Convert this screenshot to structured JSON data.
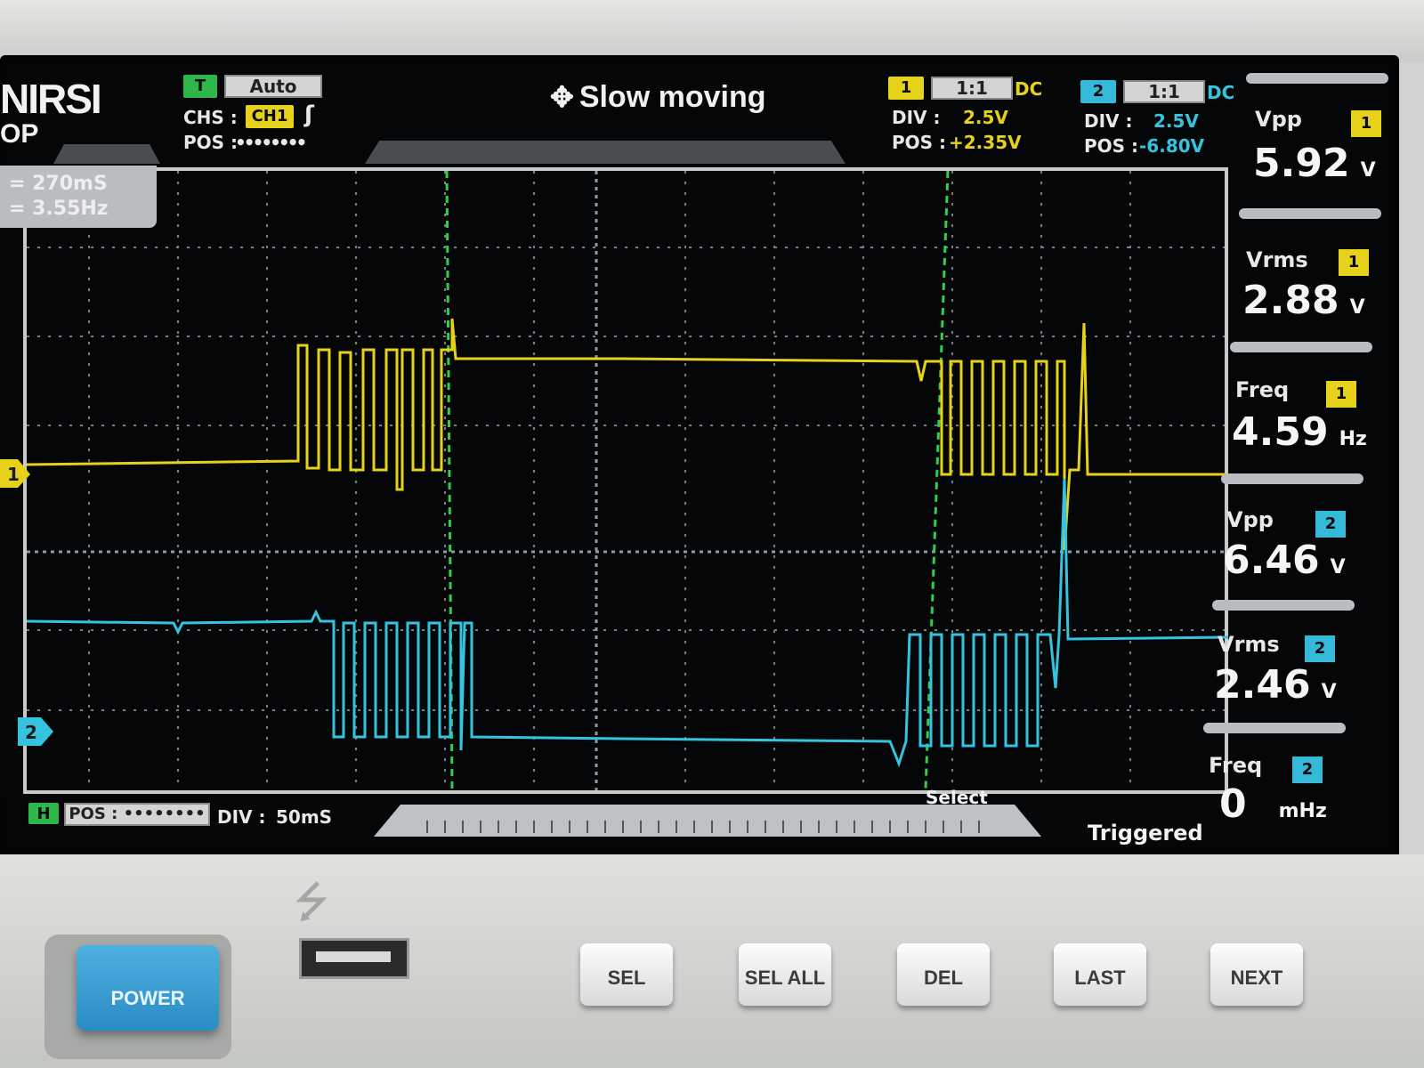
{
  "brand": {
    "logo": "NIRSI",
    "model_fragment": "OP"
  },
  "trigger": {
    "badge": "T",
    "mode": "Auto",
    "source_label": "CHS :",
    "source": "CH1",
    "edge_icon": "rising-edge-icon",
    "pos_label": "POS :",
    "pos_value": "••••••••"
  },
  "mode_indicator": {
    "icon": "move-arrows-icon",
    "text": "Slow moving"
  },
  "ch1": {
    "badge": "1",
    "probe": "1:1",
    "coupling": "DC",
    "div_label": "DIV :",
    "div_value": "2.5V",
    "pos_label": "POS :",
    "pos_value": "+2.35V",
    "marker": "1",
    "color": "#e6d21a"
  },
  "ch2": {
    "badge": "2",
    "probe": "1:1",
    "coupling": "DC",
    "div_label": "DIV :",
    "div_value": "2.5V",
    "pos_label": "POS :",
    "pos_value": "-6.80V",
    "marker": "2",
    "color": "#35c4e0"
  },
  "cursor_readout": {
    "line1": "= 270mS",
    "line2": "= 3.55Hz"
  },
  "measurements": [
    {
      "name": "Vpp",
      "channel": "1",
      "value": "5.92",
      "unit": "V"
    },
    {
      "name": "Vrms",
      "channel": "1",
      "value": "2.88",
      "unit": "V"
    },
    {
      "name": "Freq",
      "channel": "1",
      "value": "4.59",
      "unit": "Hz"
    },
    {
      "name": "Vpp",
      "channel": "2",
      "value": "6.46",
      "unit": "V"
    },
    {
      "name": "Vrms",
      "channel": "2",
      "value": "2.46",
      "unit": "V"
    },
    {
      "name": "Freq",
      "channel": "2",
      "value": "0",
      "unit": "mHz"
    }
  ],
  "timebase": {
    "badge": "H",
    "pos_label": "POS :",
    "pos_value": "••••••••",
    "div_label": "DIV :",
    "div_value": "50mS"
  },
  "status": {
    "select": "Select",
    "triggered": "Triggered"
  },
  "buttons": {
    "power": "POWER",
    "sel": "SEL",
    "sel_all": "SEL ALL",
    "del": "DEL",
    "last": "LAST",
    "next": "NEXT"
  },
  "usb_icon": "usb-icon"
}
